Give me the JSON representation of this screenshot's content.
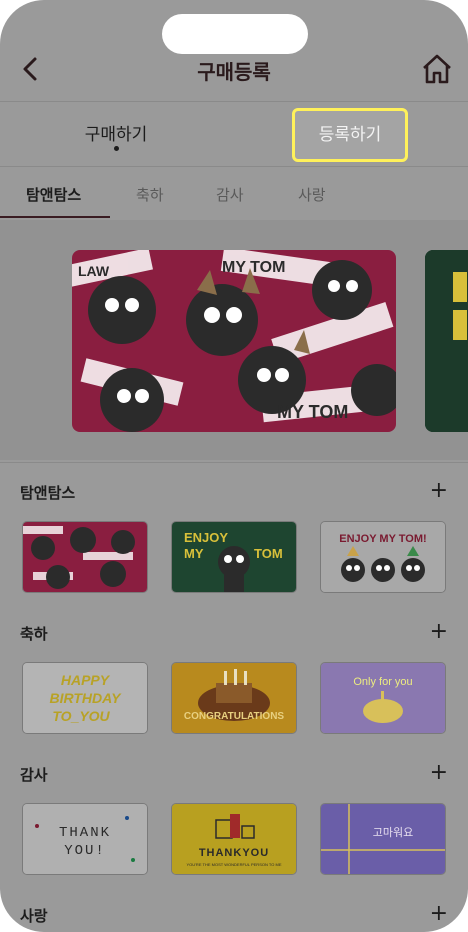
{
  "header": {
    "title": "구매등록"
  },
  "segment": {
    "buy_label": "구매하기",
    "register_label": "등록하기"
  },
  "categories": [
    "탐앤탐스",
    "축하",
    "감사",
    "사랑"
  ],
  "sections": [
    {
      "title": "탐앤탐스",
      "cards": [
        {
          "text": ""
        },
        {
          "line1": "ENJOY",
          "line2": "MY",
          "line3": "TOM"
        },
        {
          "text": "ENJOY MY TOM!"
        }
      ]
    },
    {
      "title": "축하",
      "cards": [
        {
          "line1": "HAPPY",
          "line2": "BIRTHDAY",
          "line3": "TO_YOU"
        },
        {
          "text": "CONGRATULATIONS"
        },
        {
          "text": "Only for you"
        }
      ]
    },
    {
      "title": "감사",
      "cards": [
        {
          "line1": "THANK",
          "line2": "YOU!"
        },
        {
          "text": "THANKYOU",
          "sub": "YOU'RE THE MOST WONDERFUL PERSON TO ME"
        },
        {
          "text": "고마워요"
        }
      ]
    },
    {
      "title": "사랑"
    }
  ],
  "plus_symbol": "+",
  "hero": {
    "mytom": "MY TOM",
    "law": "LAW"
  },
  "icons": {
    "back": "back-chevron-icon",
    "home": "home-icon"
  },
  "colors": {
    "accent": "#fff15a",
    "overlay": "#9a9a9a",
    "brand_dark": "#3a1c22",
    "magenta": "#b0204e",
    "green": "#1f4a33"
  }
}
